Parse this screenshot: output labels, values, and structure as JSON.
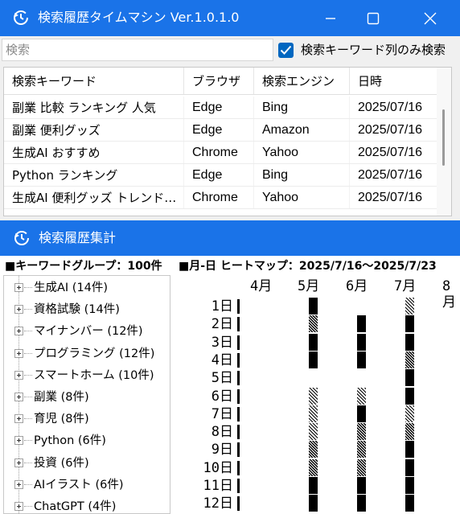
{
  "window1": {
    "title": "検索履歴タイムマシン Ver.1.0.1.0",
    "search": {
      "placeholder": "検索",
      "value": ""
    },
    "checkbox": {
      "label": "検索キーワード列のみ検索",
      "checked": true
    },
    "table": {
      "columns": [
        "検索キーワード",
        "ブラウザ",
        "検索エンジン",
        "日時"
      ],
      "rows": [
        [
          "副業 比較 ランキング 人気",
          "Edge",
          "Bing",
          "2025/07/16"
        ],
        [
          "副業 便利グッズ",
          "Edge",
          "Amazon",
          "2025/07/16"
        ],
        [
          "生成AI おすすめ",
          "Chrome",
          "Yahoo",
          "2025/07/16"
        ],
        [
          "Python ランキング",
          "Edge",
          "Bing",
          "2025/07/16"
        ],
        [
          "生成AI 便利グッズ トレンド…",
          "Chrome",
          "Yahoo",
          "2025/07/16"
        ]
      ]
    }
  },
  "window2": {
    "title": "検索履歴集計",
    "group_header": "■キーワードグループ：100件",
    "heatmap_header": "■月-日 ヒートマップ：2025/7/16～2025/7/23",
    "groups": [
      "生成AI (14件)",
      "資格試験 (14件)",
      "マイナンバー (12件)",
      "プログラミング (12件)",
      "スマートホーム (10件)",
      "副業 (8件)",
      "育児 (8件)",
      "Python (6件)",
      "投資 (6件)",
      "AIイラスト (6件)",
      "ChatGPT (4件)"
    ],
    "months": [
      "4月",
      "5月",
      "6月",
      "7月",
      "8月"
    ],
    "days": [
      "1日",
      "2日",
      "3日",
      "4日",
      "5日",
      "6日",
      "7日",
      "8日",
      "9日",
      "10日",
      "11日",
      "12日"
    ],
    "heat": [
      [
        0,
        4,
        0,
        1
      ],
      [
        0,
        2,
        4,
        4
      ],
      [
        0,
        4,
        4,
        4
      ],
      [
        0,
        4,
        4,
        2
      ],
      [
        0,
        0,
        0,
        4
      ],
      [
        0,
        1,
        1,
        4
      ],
      [
        0,
        1,
        4,
        1
      ],
      [
        0,
        1,
        2,
        2
      ],
      [
        0,
        2,
        2,
        4
      ],
      [
        0,
        2,
        2,
        4
      ],
      [
        0,
        4,
        4,
        4
      ],
      [
        0,
        4,
        4,
        4
      ]
    ]
  },
  "colors": {
    "titlebar": "#1a73e8",
    "checkbox": "#0067c0"
  },
  "icons": [
    "history-clock-icon",
    "minimize-icon",
    "maximize-icon",
    "close-icon",
    "checkmark-icon",
    "tree-expand-icon"
  ]
}
